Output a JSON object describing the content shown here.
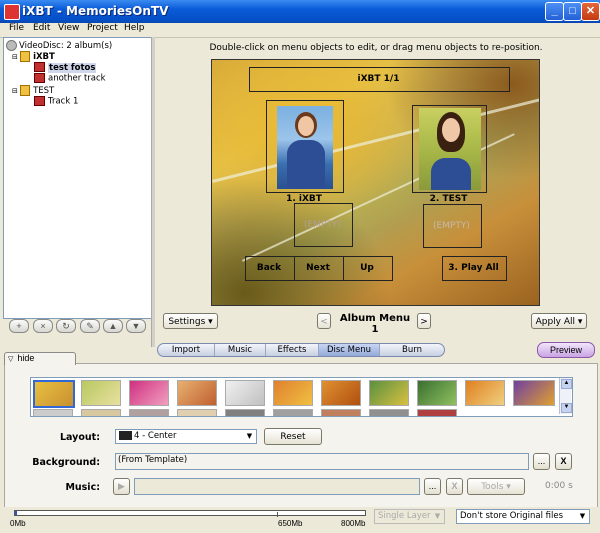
{
  "window": {
    "title": "iXBT - MemoriesOnTV"
  },
  "menu": [
    "File",
    "Edit",
    "View",
    "Project",
    "Help"
  ],
  "tree": {
    "root": "VideoDisc: 2 album(s)",
    "albums": [
      {
        "name": "iXBT",
        "tracks": [
          "test fotos",
          "another track"
        ],
        "selected_track": "test fotos"
      },
      {
        "name": "TEST",
        "tracks": [
          "Track 1"
        ]
      }
    ]
  },
  "instruction": "Double-click on menu objects to edit, or drag menu objects to re-position.",
  "menu_preview": {
    "title": "iXBT 1/1",
    "item1": "1. iXBT",
    "item2": "2. TEST",
    "empty1": "(EMPTY)",
    "empty2": "(EMPTY)",
    "nav_back": "Back",
    "nav_next": "Next",
    "nav_up": "Up",
    "play_all": "3. Play All"
  },
  "controls": {
    "settings": "Settings",
    "album_menu": "Album Menu 1",
    "apply_all": "Apply All",
    "prev": "<",
    "next": ">"
  },
  "tabs": [
    "Import",
    "Music",
    "Effects",
    "Disc Menu",
    "Burn"
  ],
  "active_tab": "Disc Menu",
  "preview_button": "Preview",
  "hide_tab": "hide",
  "form": {
    "layout_label": "Layout:",
    "layout_value": "4 - Center",
    "reset": "Reset",
    "background_label": "Background:",
    "background_value": "(From Template)",
    "browse": "...",
    "clear": "X",
    "music_label": "Music:",
    "tools": "Tools",
    "duration": "0:00 s"
  },
  "status": {
    "size_0": "0Mb",
    "size_650": "650Mb",
    "size_800": "800Mb",
    "layer": "Single Layer",
    "store": "Don't store Original files",
    "disc_usage_fraction": 0.0
  },
  "colors": {
    "accent": "#0a5bd8",
    "active_tab": "#93a9d9",
    "preview": "#c9a3e4"
  }
}
